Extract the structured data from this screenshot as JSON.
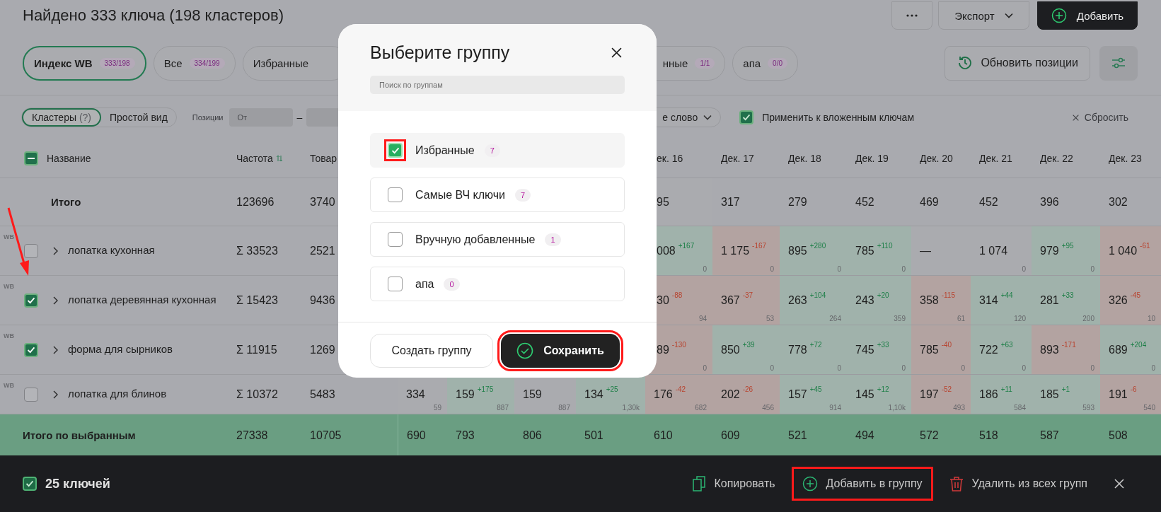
{
  "header": {
    "title": "Найдено 333 ключа (198 кластеров)",
    "buttons": [
      {
        "kind": "more"
      },
      {
        "kind": "dropdown",
        "label": "Экспорт"
      },
      {
        "kind": "primary",
        "label": "Добавить"
      }
    ]
  },
  "tabs": [
    {
      "label": "Индекс WB",
      "count": "333/198",
      "selected": true,
      "kind": "full"
    },
    {
      "label": "Все",
      "count": "334/199",
      "selected": false,
      "kind": "full"
    },
    {
      "label": "Избранные",
      "selected": false,
      "kind": "under_right"
    },
    {
      "label": "нные",
      "count": "1/1",
      "selected": false,
      "kind": "under_left"
    },
    {
      "label": "апа",
      "count": "0/0",
      "selected": false,
      "kind": "full"
    }
  ],
  "tab_actions": [
    {
      "kind": "refresh",
      "label": "Обновить позиции"
    },
    {
      "kind": "settings"
    }
  ],
  "filters": {
    "view_modes": [
      {
        "label": "Кластеры",
        "hint": "(?)",
        "selected": true
      },
      {
        "label": "Простой вид",
        "selected": false
      }
    ],
    "positions_label": "Позиции",
    "from_placeholder": "От",
    "range_dash": "–",
    "word_dropdown": "е слово",
    "apply_nested": {
      "label": "Применить к вложенным ключам",
      "checked": true
    },
    "reset": "Сбросить"
  },
  "table": {
    "select_partial": true,
    "name_header": "Название",
    "columns": [
      "Частота",
      "Товар"
    ],
    "date_headers": [
      "ек. 16",
      "Дек. 17",
      "Дек. 18",
      "Дек. 19",
      "Дек. 20",
      "Дек. 21",
      "Дек. 22",
      "Дек. 23"
    ],
    "totals": {
      "name": "Итого",
      "frequency": "123696",
      "goods": "3740",
      "cells": [
        "",
        "",
        "",
        "",
        "95",
        "317",
        "279",
        "452",
        "469",
        "452",
        "396",
        "302"
      ]
    },
    "rows": [
      {
        "source": "WB",
        "checked": false,
        "name": "лопатка кухонная",
        "frequency": "Σ 33523",
        "goods": "2521",
        "cells": [
          "",
          "",
          "",
          "",
          {
            "value": "008",
            "delta": "+167",
            "sub": "0",
            "kind": "up"
          },
          {
            "value": "1 175",
            "delta": "-167",
            "sub": "0",
            "kind": "down"
          },
          {
            "value": "895",
            "delta": "+280",
            "sub": "0",
            "kind": "up"
          },
          {
            "value": "785",
            "delta": "+110",
            "sub": "0",
            "kind": "up"
          },
          {
            "value": "—",
            "kind": "flat"
          },
          {
            "value": "1 074",
            "sub": "0",
            "kind": "flat"
          },
          {
            "value": "979",
            "delta": "+95",
            "sub": "0",
            "kind": "up"
          },
          {
            "value": "1 040",
            "delta": "-61",
            "kind": "down"
          }
        ]
      },
      {
        "source": "WB",
        "checked": true,
        "name": "лопатка деревянная кухонная",
        "frequency": "Σ 15423",
        "goods": "9436",
        "cells": [
          "",
          "",
          "",
          "",
          {
            "value": "30",
            "delta": "-88",
            "sub": "94",
            "kind": "down"
          },
          {
            "value": "367",
            "delta": "-37",
            "sub": "53",
            "kind": "down"
          },
          {
            "value": "263",
            "delta": "+104",
            "sub": "264",
            "kind": "up"
          },
          {
            "value": "243",
            "delta": "+20",
            "sub": "359",
            "kind": "up"
          },
          {
            "value": "358",
            "delta": "-115",
            "sub": "61",
            "kind": "down"
          },
          {
            "value": "314",
            "delta": "+44",
            "sub": "120",
            "kind": "up"
          },
          {
            "value": "281",
            "delta": "+33",
            "sub": "200",
            "kind": "up"
          },
          {
            "value": "326",
            "delta": "-45",
            "sub": "10",
            "kind": "down"
          }
        ]
      },
      {
        "source": "WB",
        "checked": true,
        "name": "форма для сырников",
        "frequency": "Σ 11915",
        "goods": "1269",
        "cells": [
          "",
          "",
          "",
          "",
          {
            "value": "89",
            "delta": "-130",
            "sub": "0",
            "kind": "down"
          },
          {
            "value": "850",
            "delta": "+39",
            "sub": "0",
            "kind": "up"
          },
          {
            "value": "778",
            "delta": "+72",
            "sub": "0",
            "kind": "up"
          },
          {
            "value": "745",
            "delta": "+33",
            "sub": "0",
            "kind": "up"
          },
          {
            "value": "785",
            "delta": "-40",
            "sub": "0",
            "kind": "down"
          },
          {
            "value": "722",
            "delta": "+63",
            "sub": "0",
            "kind": "up"
          },
          {
            "value": "893",
            "delta": "-171",
            "sub": "0",
            "kind": "down"
          },
          {
            "value": "689",
            "delta": "+204",
            "sub": "0",
            "kind": "up"
          }
        ]
      },
      {
        "source": "WB",
        "checked": false,
        "name": "лопатка для блинов",
        "frequency": "Σ 10372",
        "goods": "5483",
        "cells": [
          {
            "value": "334",
            "sub": "59",
            "kind": "flat"
          },
          {
            "value": "159",
            "delta": "+175",
            "sub": "887",
            "kind": "up"
          },
          {
            "value": "159",
            "sub": "887",
            "kind": "flat"
          },
          {
            "value": "134",
            "delta": "+25",
            "sub": "1,30k",
            "kind": "up"
          },
          {
            "value": "176",
            "delta": "-42",
            "sub": "682",
            "kind": "down"
          },
          {
            "value": "202",
            "delta": "-26",
            "sub": "456",
            "kind": "down"
          },
          {
            "value": "157",
            "delta": "+45",
            "sub": "914",
            "kind": "up"
          },
          {
            "value": "145",
            "delta": "+12",
            "sub": "1,10k",
            "kind": "up"
          },
          {
            "value": "197",
            "delta": "-52",
            "sub": "493",
            "kind": "down"
          },
          {
            "value": "186",
            "delta": "+11",
            "sub": "584",
            "kind": "up"
          },
          {
            "value": "185",
            "delta": "+1",
            "sub": "593",
            "kind": "up"
          },
          {
            "value": "191",
            "delta": "-6",
            "sub": "540",
            "kind": "down"
          }
        ]
      }
    ],
    "selected_totals": {
      "name": "Итого по выбранным",
      "frequency": "27338",
      "goods": "10705",
      "cells": [
        "690",
        "793",
        "806",
        "501",
        "610",
        "609",
        "521",
        "494",
        "572",
        "518",
        "587",
        "508"
      ]
    }
  },
  "bottom_bar": {
    "checked": true,
    "count": "25 ключей",
    "actions": [
      {
        "kind": "copy",
        "label": "Копировать",
        "highlighted": false
      },
      {
        "kind": "add",
        "label": "Добавить в группу",
        "highlighted": true
      },
      {
        "kind": "delete",
        "label": "Удалить из всех групп",
        "highlighted": false
      },
      {
        "kind": "close",
        "highlighted": false
      }
    ]
  },
  "dialog": {
    "title": "Выберите группу",
    "search_placeholder": "Поиск по группам",
    "groups": [
      {
        "name": "Избранные",
        "count": "7",
        "checked": true,
        "highlighted": true
      },
      {
        "name": "Самые ВЧ ключи",
        "count": "7",
        "checked": false,
        "highlighted": false
      },
      {
        "name": "Вручную добавленные",
        "count": "1",
        "checked": false,
        "highlighted": false
      },
      {
        "name": "апа",
        "count": "0",
        "checked": false,
        "highlighted": false
      }
    ],
    "buttons": [
      {
        "kind": "secondary",
        "label": "Создать группу",
        "highlighted": false
      },
      {
        "kind": "primary",
        "label": "Сохранить",
        "highlighted": true
      }
    ]
  }
}
